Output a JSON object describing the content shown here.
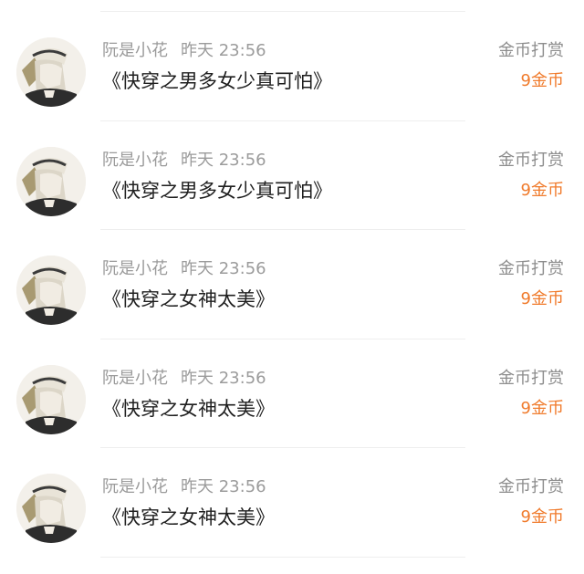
{
  "rewards": [
    {
      "user": "阮是小花",
      "time": "昨天 23:56",
      "book_title": "《快穿之男多女少真可怕》",
      "gift_label": "金币打赏",
      "gift_amount": "9金币"
    },
    {
      "user": "阮是小花",
      "time": "昨天 23:56",
      "book_title": "《快穿之男多女少真可怕》",
      "gift_label": "金币打赏",
      "gift_amount": "9金币"
    },
    {
      "user": "阮是小花",
      "time": "昨天 23:56",
      "book_title": "《快穿之女神太美》",
      "gift_label": "金币打赏",
      "gift_amount": "9金币"
    },
    {
      "user": "阮是小花",
      "time": "昨天 23:56",
      "book_title": "《快穿之女神太美》",
      "gift_label": "金币打赏",
      "gift_amount": "9金币"
    },
    {
      "user": "阮是小花",
      "time": "昨天 23:56",
      "book_title": "《快穿之女神太美》",
      "gift_label": "金币打赏",
      "gift_amount": "9金币"
    }
  ],
  "colors": {
    "meta_text": "#9b9b9b",
    "title_text": "#1f1f1f",
    "gift_label": "#8d8d8d",
    "gift_amount": "#f07b2c",
    "divider": "#eeeeee"
  },
  "icons": {
    "avatar": "user-avatar-illustration"
  }
}
